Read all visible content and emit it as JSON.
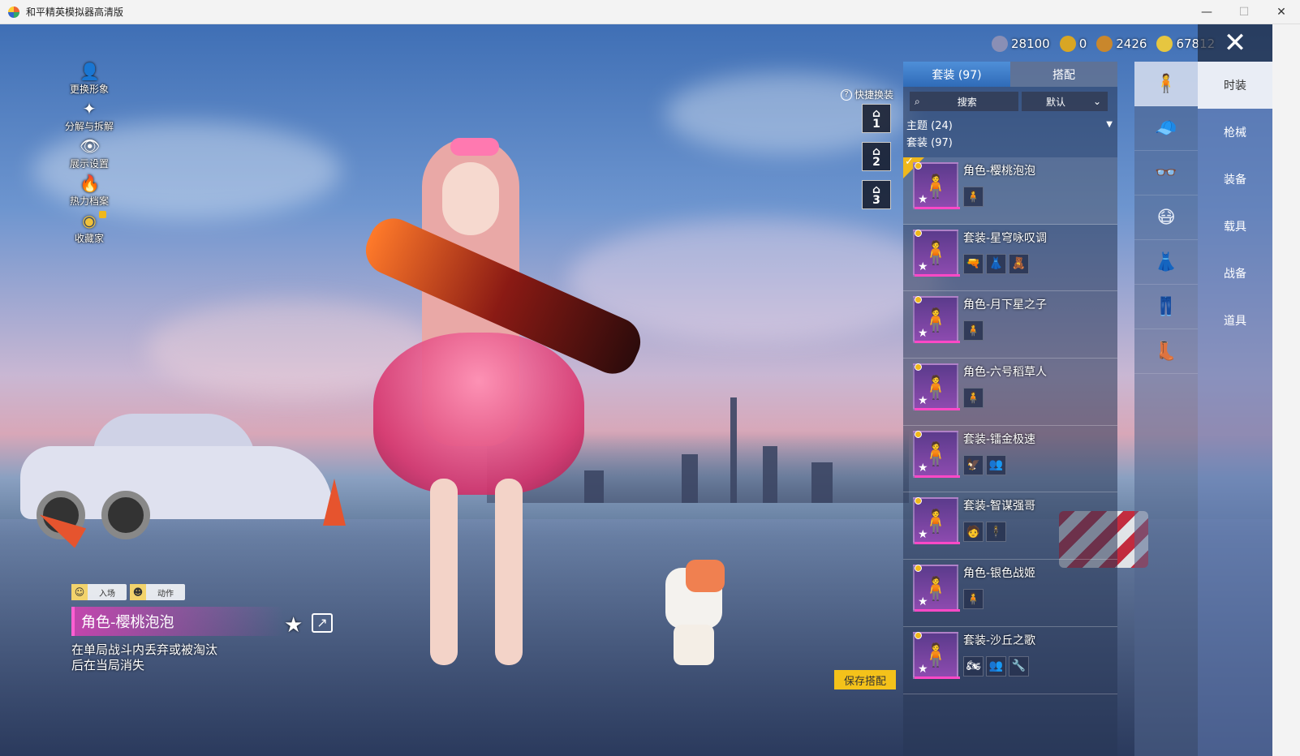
{
  "window": {
    "title": "和平精英模拟器高清版",
    "btn_min": "—",
    "btn_max": "☐",
    "btn_close": "✕"
  },
  "left_menu": [
    {
      "icon": "👤",
      "label": "更换形象"
    },
    {
      "icon": "✦",
      "label": "分解与拆解"
    },
    {
      "icon": "👁",
      "label": "展示设置"
    },
    {
      "icon": "🔥",
      "label": "热力档案"
    },
    {
      "icon": "◉",
      "label": "收藏家"
    }
  ],
  "info": {
    "entry_label": "入场",
    "action_label": "动作",
    "item_name": "角色-樱桃泡泡",
    "description": "在单局战斗内丢弃或被淘汰后在当局消失"
  },
  "quick_change": {
    "label": "快捷换装",
    "slots": [
      "1",
      "2",
      "3"
    ]
  },
  "currency": [
    {
      "value": "28100",
      "color": "#8a8fb5"
    },
    {
      "value": "0",
      "color": "#d8a624"
    },
    {
      "value": "2426",
      "color": "#c9872c"
    },
    {
      "value": "67812",
      "color": "#e6c640"
    }
  ],
  "close_icon": "✕",
  "panel": {
    "tabs": [
      "套装 (97)",
      "搭配"
    ],
    "search_placeholder": "搜索",
    "sort_value": "默认",
    "group_theme": "主题 (24)",
    "group_suits": "套装 (97)",
    "items": [
      {
        "name": "角色-樱桃泡泡",
        "parts": [
          "🧍"
        ],
        "selected": true
      },
      {
        "name": "套装-星穹咏叹调",
        "parts": [
          "🔫",
          "👗",
          "🧸"
        ]
      },
      {
        "name": "角色-月下星之子",
        "parts": [
          "🧍"
        ]
      },
      {
        "name": "角色-六号稻草人",
        "parts": [
          "🧍"
        ]
      },
      {
        "name": "套装-镭金极速",
        "parts": [
          "🦅",
          "👥"
        ]
      },
      {
        "name": "套装-智谋强哥",
        "parts": [
          "🧑",
          "🕴"
        ]
      },
      {
        "name": "角色-银色战姬",
        "parts": [
          "🧍"
        ]
      },
      {
        "name": "套装-沙丘之歌",
        "parts": [
          "🏍",
          "👥",
          "🔧"
        ]
      }
    ]
  },
  "categories": [
    "🧍",
    "🧢",
    "👓",
    "😷",
    "👗",
    "👖",
    "👢"
  ],
  "main_nav": [
    "时装",
    "枪械",
    "装备",
    "载具",
    "战备",
    "道具"
  ],
  "save_button": "保存搭配"
}
